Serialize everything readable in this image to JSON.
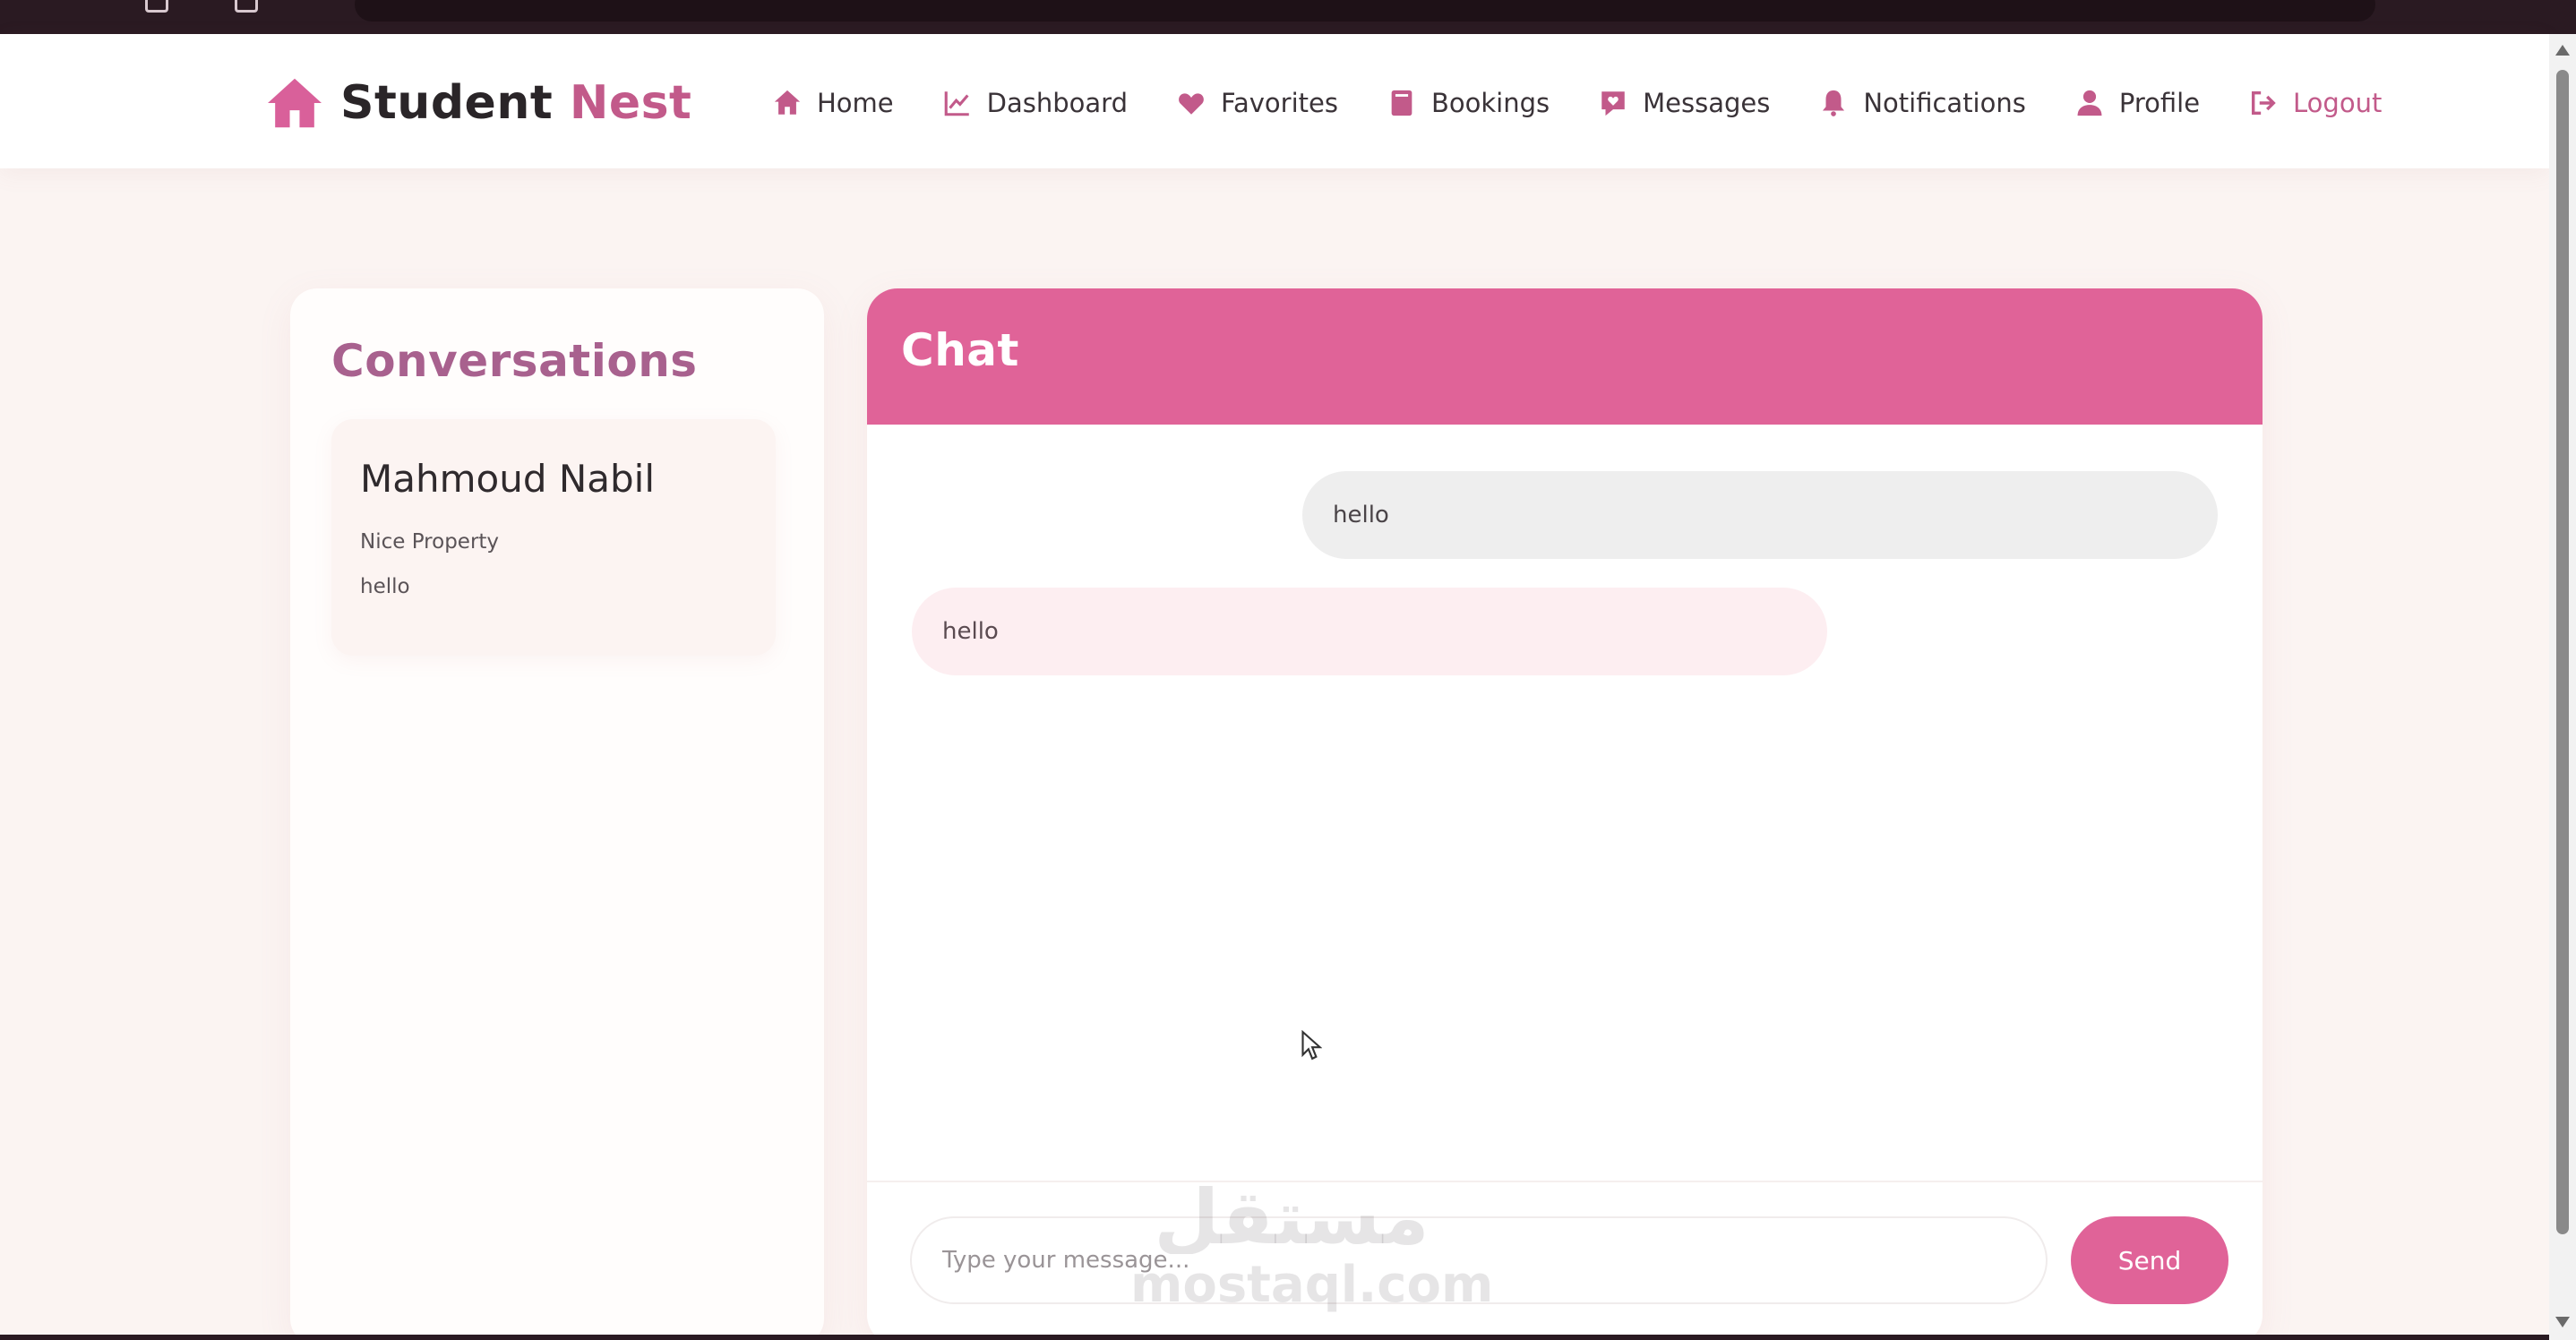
{
  "brand": {
    "name": "Student",
    "accent": "Nest"
  },
  "nav": {
    "home": "Home",
    "dashboard": "Dashboard",
    "favorites": "Favorites",
    "bookings": "Bookings",
    "messages": "Messages",
    "notifications": "Notifications",
    "profile": "Profile",
    "logout": "Logout"
  },
  "conversations": {
    "title": "Conversations",
    "items": [
      {
        "name": "Mahmoud Nabil",
        "property": "Nice Property",
        "last_message": "hello"
      }
    ]
  },
  "chat": {
    "title": "Chat",
    "messages": [
      {
        "direction": "sent",
        "text": "hello"
      },
      {
        "direction": "received",
        "text": "hello"
      }
    ],
    "input_placeholder": "Type your message...",
    "send_label": "Send"
  },
  "watermark": {
    "text": "mostaql.com",
    "mark": "مستقل"
  },
  "colors": {
    "accent": "#e06398",
    "accent_dark": "#c25a8a",
    "background": "#fbf4f2"
  },
  "icons": {
    "brand": "house-icon",
    "home": "house-icon",
    "dashboard": "line-chart-icon",
    "favorites": "heart-icon",
    "bookings": "book-icon",
    "messages": "chat-heart-icon",
    "notifications": "bell-icon",
    "profile": "user-icon",
    "logout": "sign-out-icon"
  }
}
